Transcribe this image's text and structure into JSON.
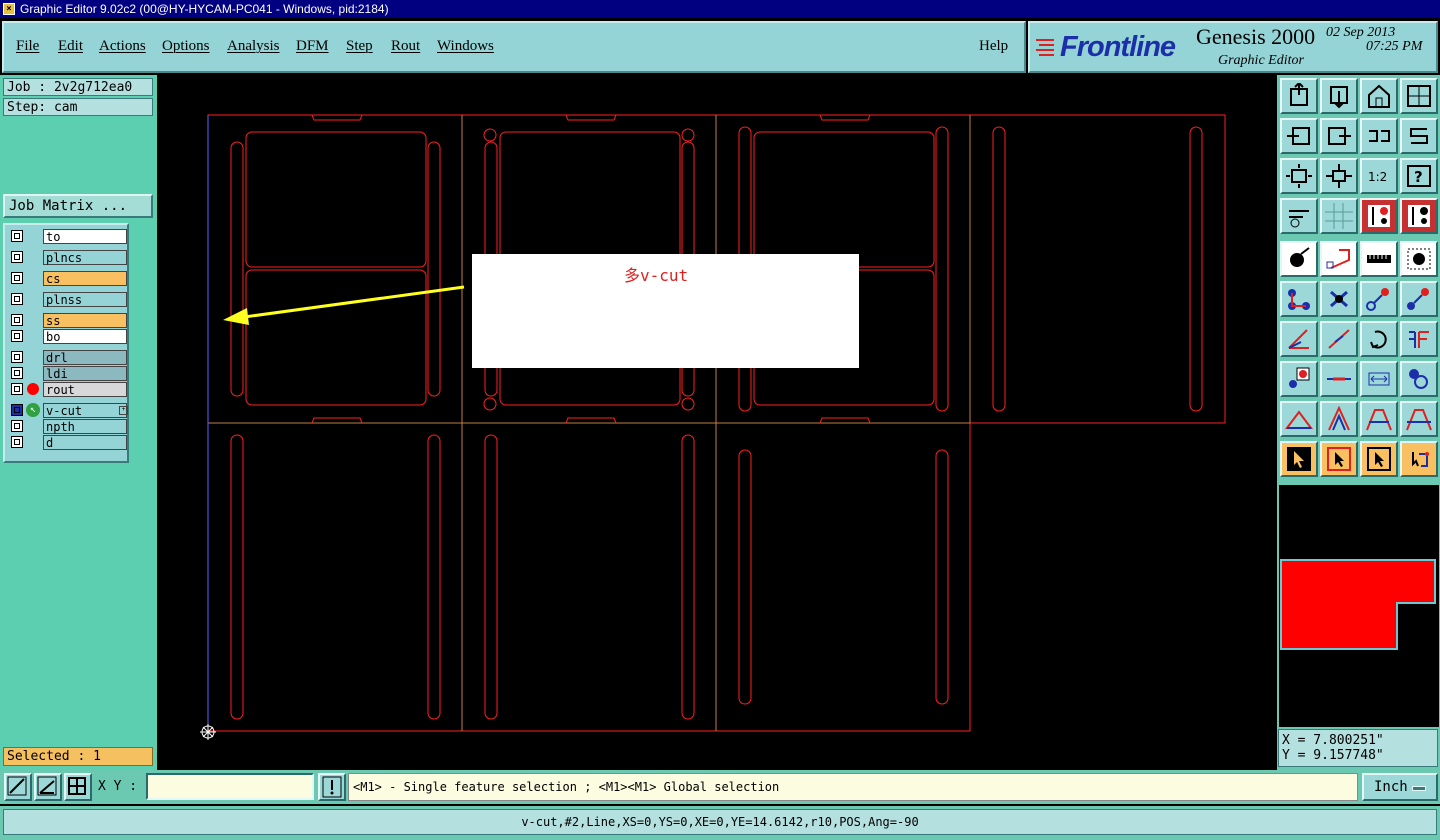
{
  "window": {
    "title": "Graphic Editor 9.02c2 (00@HY-HYCAM-PC041 - Windows, pid:2184)"
  },
  "menu": [
    {
      "label": "File"
    },
    {
      "label": "Edit"
    },
    {
      "label": "Actions"
    },
    {
      "label": "Options"
    },
    {
      "label": "Analysis"
    },
    {
      "label": "DFM"
    },
    {
      "label": "Step"
    },
    {
      "label": "Rout"
    },
    {
      "label": "Windows"
    }
  ],
  "help_label": "Help",
  "brand": {
    "logo": "Frontline",
    "product": "Genesis 2000",
    "date": "02 Sep 2013",
    "time": "07:25 PM",
    "subtitle": "Graphic Editor"
  },
  "job": {
    "job_text": "Job : 2v2g712ea0",
    "step_text": "Step: cam",
    "matrix_label": "Job Matrix ..."
  },
  "layers": [
    {
      "name": "to",
      "color": "#ffffff"
    },
    {
      "name": "plncs",
      "color": "#94d4d6"
    },
    {
      "name": "cs",
      "color": "#f8c060"
    },
    {
      "name": "plnss",
      "color": "#94d4d6"
    },
    {
      "name": "ss",
      "color": "#f8c060"
    },
    {
      "name": "bo",
      "color": "#ffffff"
    },
    {
      "name": "drl",
      "color": "#8cb8c0"
    },
    {
      "name": "ldi",
      "color": "#8cb8c0"
    },
    {
      "name": "rout",
      "color": "#d8d8d8"
    },
    {
      "name": "v-cut",
      "color": "#94d4d6"
    },
    {
      "name": "npth",
      "color": "#94d4d6"
    },
    {
      "name": "d",
      "color": "#94d4d6"
    }
  ],
  "selected_text": "Selected : 1",
  "annotation": {
    "text": "多v-cut"
  },
  "coords": {
    "x": "X = 7.800251\"",
    "y": "Y = 9.157748\""
  },
  "bottom": {
    "xy_label": "X Y :",
    "xy_value": "",
    "message": "<M1> - Single feature selection ; <M1><M1> Global selection",
    "units": "Inch"
  },
  "status": "v-cut,#2,Line,XS=0,YS=0,XE=0,YE=14.6142,r10,POS,Ang=-90",
  "colors": {
    "outline": "#ff2020",
    "vcut": "#6060ff",
    "arrow": "#ffff20",
    "highlight_layer": "#f8c060"
  }
}
